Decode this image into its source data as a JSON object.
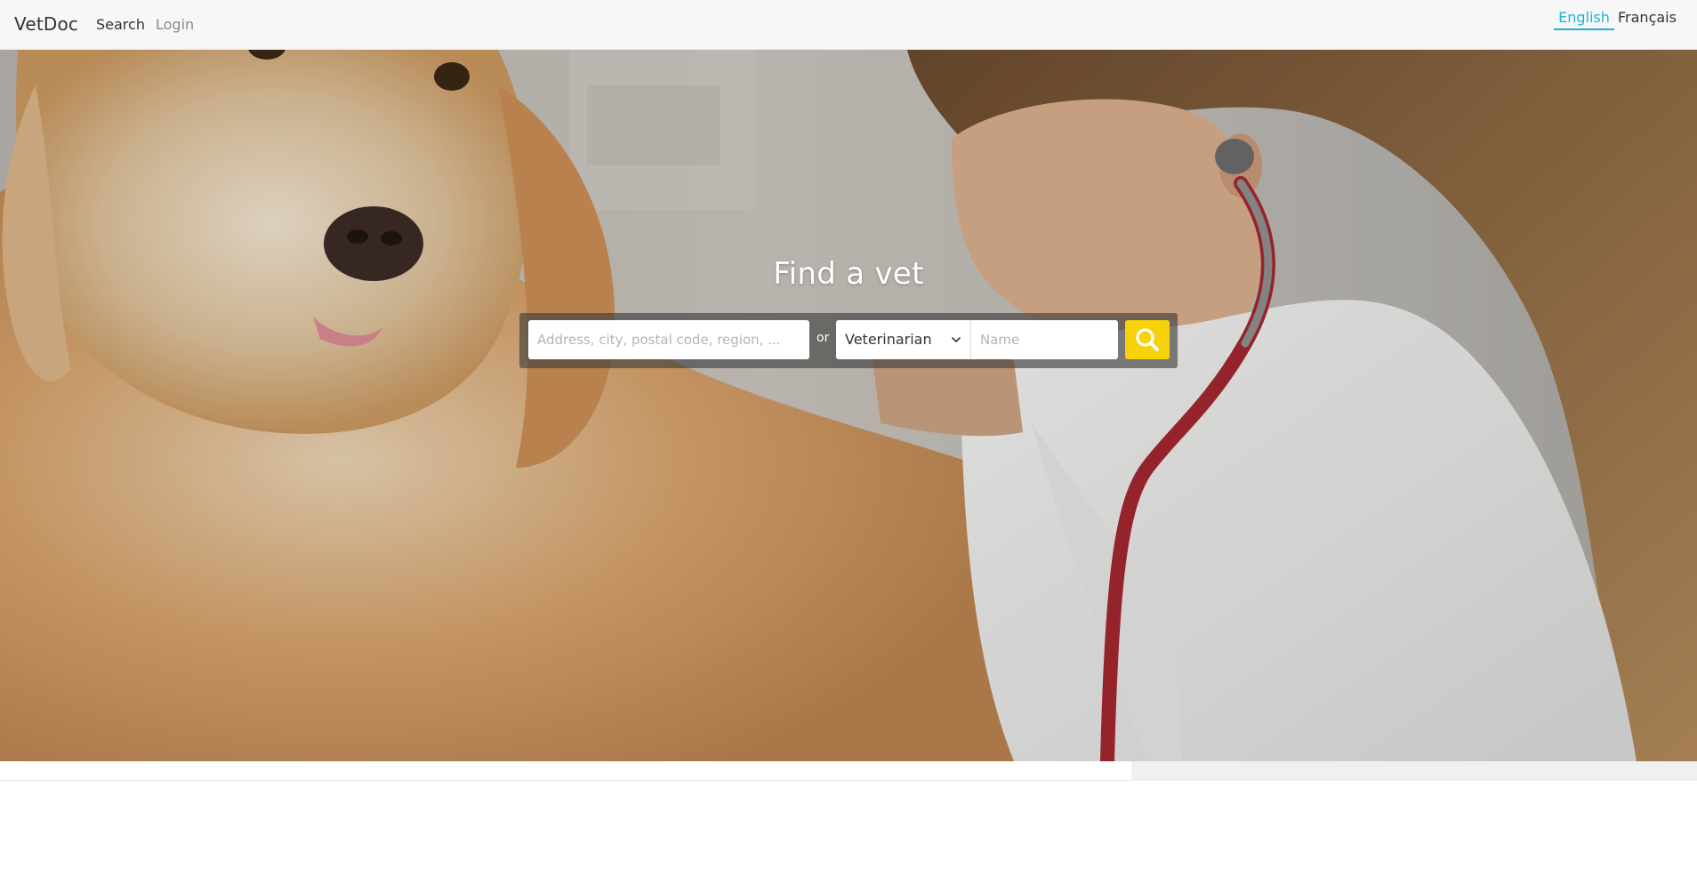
{
  "navbar": {
    "brand": "VetDoc",
    "links": {
      "search": "Search",
      "login": "Login"
    },
    "languages": {
      "english": "English",
      "french": "Français"
    }
  },
  "hero": {
    "title": "Find a vet",
    "search": {
      "address_placeholder": "Address, city, postal code, region, ...",
      "or_label": "or",
      "type_selected": "Veterinarian",
      "name_placeholder": "Name",
      "button_icon": "search-icon"
    }
  },
  "colors": {
    "accent": "#1fb3d6",
    "search_button": "#f7d20a",
    "navbar_bg": "#f7f7f7"
  }
}
